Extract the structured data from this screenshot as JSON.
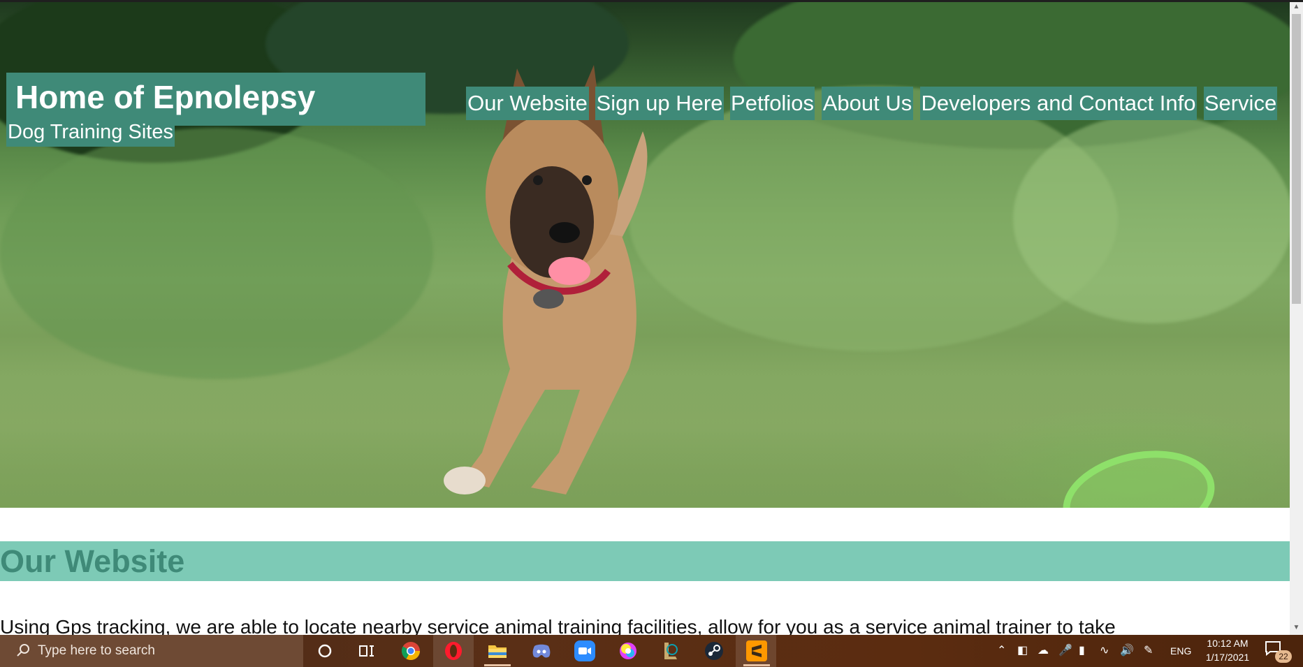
{
  "site": {
    "title": "Home of Epnolepsy",
    "subtitle": "Dog Training Sites"
  },
  "nav": {
    "items": [
      {
        "label": "Our Website"
      },
      {
        "label": "Sign up Here"
      },
      {
        "label": "Petfolios"
      },
      {
        "label": "About Us"
      },
      {
        "label": "Developers and Contact Info"
      },
      {
        "label": "Service"
      }
    ]
  },
  "section": {
    "heading": "Our Website",
    "body": "Using Gps tracking, we are able to locate nearby service animal training facilities, allow for you as a service animal trainer to take"
  },
  "colors": {
    "brand": "#3f8a78",
    "section_bar": "#7dcab6"
  },
  "taskbar": {
    "search_placeholder": "Type here to search",
    "apps": [
      "cortana-icon",
      "task-view-icon",
      "chrome-icon",
      "opera-icon",
      "file-explorer-icon",
      "discord-icon",
      "zoom-icon",
      "paint-icon",
      "league-icon",
      "steam-icon",
      "sublime-text-icon"
    ],
    "language": "ENG",
    "time": "10:12 AM",
    "date": "1/17/2021",
    "notifications": "22"
  }
}
